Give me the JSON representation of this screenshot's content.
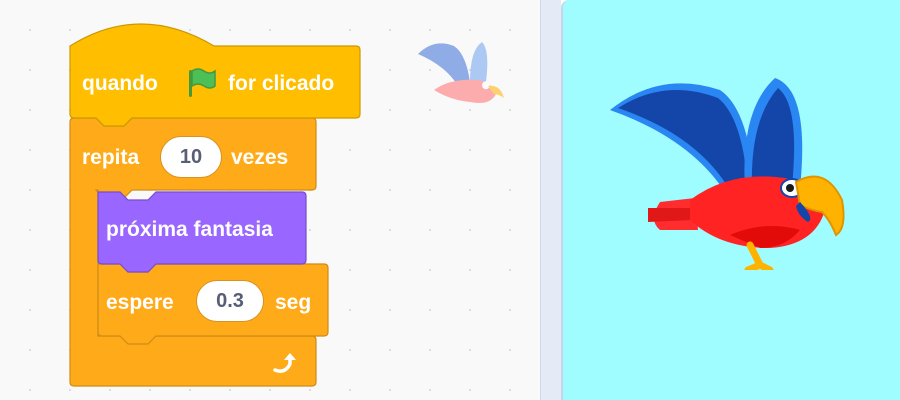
{
  "blocks": {
    "when_flag": {
      "word1": "quando",
      "word2": "for clicado"
    },
    "repeat": {
      "word1": "repita",
      "count": "10",
      "word2": "vezes"
    },
    "costume": {
      "label": "próxima fantasia"
    },
    "wait": {
      "word1": "espere",
      "seconds": "0.3",
      "word2": "seg"
    }
  },
  "colors": {
    "events": "#ffbf00",
    "control": "#ffab19",
    "looks": "#9966ff",
    "stage_bg": "#9ffcff",
    "workspace_bg": "#f9f9f9"
  },
  "icons": [
    "green-flag-icon",
    "loop-arrow-icon",
    "parrot-sprite"
  ]
}
